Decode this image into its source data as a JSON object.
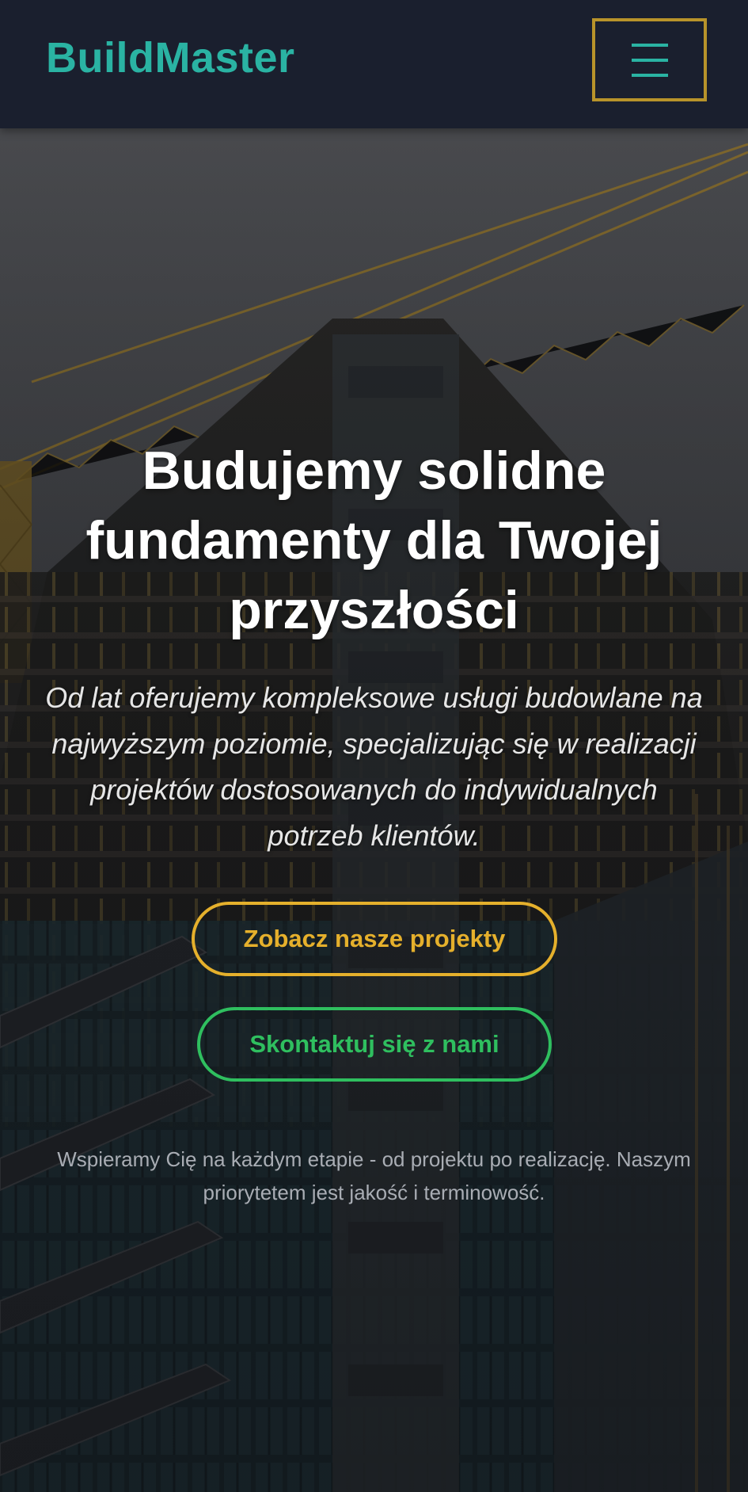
{
  "header": {
    "logo": "BuildMaster",
    "menu_icon": "hamburger-menu-icon"
  },
  "hero": {
    "background": "construction-crane-building-photo",
    "headline": "Budujemy solidne fundamenty dla Twojej przyszłości",
    "subheadline": "Od lat oferujemy kompleksowe usługi budowlane na najwyższym poziomie, specjalizując się w realizacji projektów dostosowanych do indywidualnych potrzeb klientów.",
    "cta_projects": "Zobacz nasze projekty",
    "cta_contact": "Skontaktuj się z nami",
    "note": "Wspieramy Cię na każdym etapie - od projektu po realizację. Naszym priorytetem jest jakość i terminowość."
  },
  "colors": {
    "header_bg": "#1a1f2e",
    "logo": "#2ab3a3",
    "menu_border": "#b8932a",
    "cta_projects": "#e5b02c",
    "cta_contact": "#2fbf5f"
  }
}
